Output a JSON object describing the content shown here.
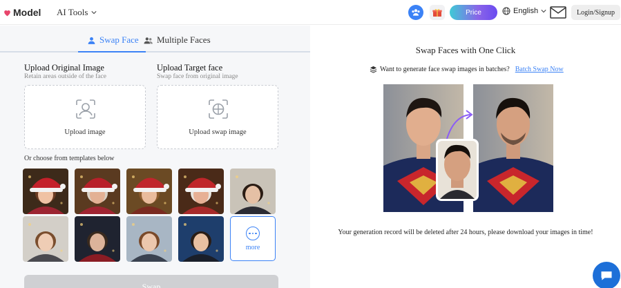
{
  "header": {
    "logo_text": "Model",
    "ai_tools_label": "AI Tools",
    "price_label": "Price",
    "language_label": "English",
    "login_label": "Login/Signup"
  },
  "tabs": [
    {
      "label": "Swap Face",
      "active": true,
      "icon": "user-icon"
    },
    {
      "label": "Multiple Faces",
      "active": false,
      "icon": "users-icon"
    }
  ],
  "upload": {
    "original": {
      "title": "Upload Original Image",
      "subtitle": "Retain areas outside of the face",
      "button_label": "Upload image"
    },
    "target": {
      "title": "Upload Target face",
      "subtitle": "Swap face from original image",
      "button_label": "Upload swap image"
    }
  },
  "templates": {
    "label": "Or choose from templates below",
    "more_label": "more",
    "items": [
      {
        "name": "template-girl-santa-hat",
        "bg": "#3d2a1a",
        "skin": "#f0c2a4",
        "hair": "#6b3b22",
        "hat": "#c4202a",
        "cloth": "#9c2431"
      },
      {
        "name": "template-woman-santa-hat",
        "bg": "#5a3a20",
        "skin": "#e3b195",
        "hair": "#d8d0c4",
        "hat": "#b8202a",
        "cloth": "#a02431"
      },
      {
        "name": "template-woman-santa-hat-2",
        "bg": "#6b4a24",
        "skin": "#e9bb9c",
        "hair": "#8a5a2c",
        "hat": "#c0262c",
        "cloth": "#7a2a20"
      },
      {
        "name": "template-santa-elder",
        "bg": "#4a2a18",
        "skin": "#e7b095",
        "hair": "#e8e4de",
        "hat": "#c0262a",
        "cloth": "#a82a2a"
      },
      {
        "name": "template-wizard-boy",
        "bg": "#c9c3b8",
        "skin": "#e5c0a5",
        "hair": "#2a1c14",
        "hat": "",
        "cloth": "#2b2b33"
      },
      {
        "name": "template-wizard-girl",
        "bg": "#d3cfc8",
        "skin": "#efcdb5",
        "hair": "#7a4e2e",
        "hat": "",
        "cloth": "#4a4a50"
      },
      {
        "name": "template-spider-man",
        "bg": "#1f2330",
        "skin": "#dcb39a",
        "hair": "#3a2a1e",
        "hat": "",
        "cloth": "#8a1c24"
      },
      {
        "name": "template-school-girl",
        "bg": "#a8b6c4",
        "skin": "#ecc7ad",
        "hair": "#7a4a2a",
        "hat": "",
        "cloth": "#3a4250"
      },
      {
        "name": "template-suit-man",
        "bg": "#1e3e6c",
        "skin": "#e8c0a2",
        "hair": "#2a1d16",
        "hat": "",
        "cloth": "#1a1f2a"
      }
    ]
  },
  "swap_button_label": "Swap",
  "right_panel": {
    "title": "Swap Faces with One Click",
    "batch_text": "Want to generate face swap images in batches?",
    "batch_link": "Batch Swap Now",
    "note": "Your generation record will be deleted after 24 hours, please download your images in time!"
  },
  "colors": {
    "accent": "#3b82f6",
    "chat_button": "#1d6fd8"
  }
}
